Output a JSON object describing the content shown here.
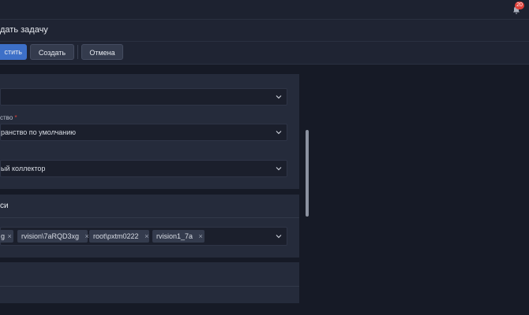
{
  "header": {
    "notifications_count": "20"
  },
  "titlebar": {
    "title": "дать задачу"
  },
  "toolbar": {
    "run_label": "стить",
    "create_label": "Создать",
    "cancel_label": "Отмена"
  },
  "form": {
    "field1": {
      "value": ""
    },
    "field2": {
      "label": "ство",
      "required_mark": "*",
      "value": "ранство по умолчанию"
    },
    "field3": {
      "value": "ый коллектор"
    }
  },
  "accounts": {
    "heading": "си",
    "tags": [
      {
        "label": "g"
      },
      {
        "label": "rvision\\7aRQD3xg"
      },
      {
        "label": "root\\pxtm0222"
      },
      {
        "label": "rvision1_7a"
      }
    ],
    "remove_glyph": "×"
  },
  "colors": {
    "accent": "#3d70c8",
    "badge": "#e0413a",
    "background": "#161a26",
    "panel": "#252b3b"
  }
}
